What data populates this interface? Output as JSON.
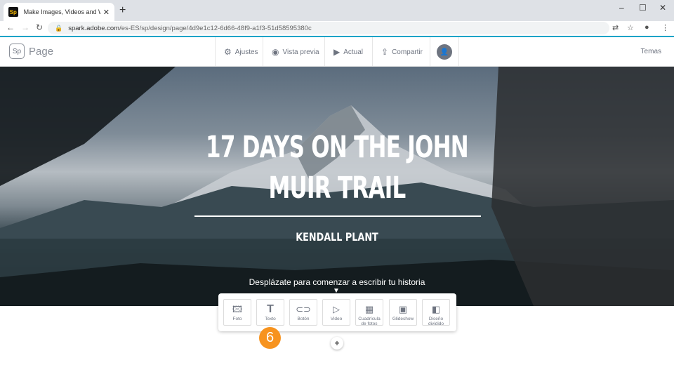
{
  "browser": {
    "tab_title": "Make Images, Videos and Web S",
    "tab_close": "✕",
    "new_tab": "+",
    "url_host": "spark.adobe.com",
    "url_path": "/es-ES/sp/design/page/4d9e1c12-6d66-48f9-a1f3-51d58595380c",
    "favicon_label": "Sp"
  },
  "header": {
    "logo_mark": "Sp",
    "app_name": "Page",
    "settings_label": "Ajustes",
    "preview_label": "Vista previa",
    "current_label": "Actual",
    "share_label": "Compartir",
    "themes_label": "Temas"
  },
  "hero": {
    "title": "17 DAYS ON THE JOHN MUIR TRAIL",
    "author": "KENDALL PLANT",
    "scroll_hint": "Desplázate para comenzar a escribir tu historia"
  },
  "inserter": {
    "items": [
      {
        "label": "Foto",
        "icon": "photo-icon"
      },
      {
        "label": "Texto",
        "icon": "text-icon"
      },
      {
        "label": "Botón",
        "icon": "link-icon"
      },
      {
        "label": "Video",
        "icon": "video-icon"
      },
      {
        "label": "Cuadrícula de fotos",
        "icon": "photo-grid-icon"
      },
      {
        "label": "Glideshow",
        "icon": "glideshow-icon"
      },
      {
        "label": "Diseño dividido",
        "icon": "split-layout-icon"
      }
    ]
  },
  "step_badge": "6",
  "colors": {
    "accent": "#1aa3c7",
    "badge": "#f7931e"
  }
}
